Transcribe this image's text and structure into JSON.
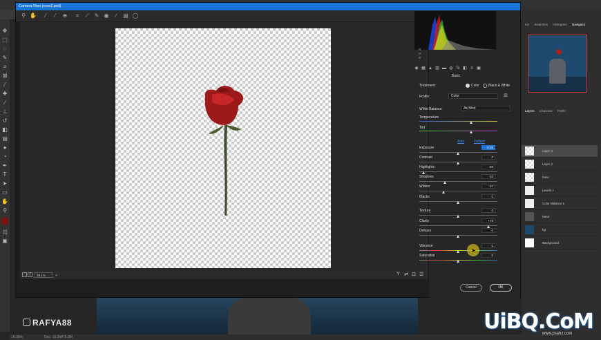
{
  "window": {
    "title": "Camera Raw (rose2.psd)"
  },
  "photoshop": {
    "navigator_tabs": [
      "Ion",
      "Swatches",
      "Histogram",
      "Navigator"
    ],
    "layers_tabs": [
      "Layers",
      "Channels",
      "Paths"
    ],
    "layers": [
      {
        "name": "Layer 3",
        "selected": true
      },
      {
        "name": "Layer 2",
        "selected": false
      },
      {
        "name": "base",
        "selected": false
      },
      {
        "name": "Levels 1",
        "selected": false
      },
      {
        "name": "Color Balance 1",
        "selected": false
      },
      {
        "name": "hand",
        "selected": false
      },
      {
        "name": "bg",
        "selected": false
      },
      {
        "name": "Background",
        "selected": false
      }
    ],
    "status_zoom": "16.35%",
    "status_doc": "Doc: 10.3M/75.3M"
  },
  "camera_raw": {
    "zoom": "38.1%",
    "readout": {
      "r": "R:",
      "g": "G:",
      "b": "B:"
    },
    "panel_title": "Basic",
    "treatment_label": "Treatment:",
    "treatment_color": "Color",
    "treatment_bw": "Black & White",
    "profile_label": "Profile:",
    "profile_value": "Color",
    "white_balance_label": "White Balance:",
    "white_balance_value": "As Shot",
    "temperature_label": "Temperature",
    "tint_label": "Tint",
    "auto_label": "Auto",
    "default_label": "Default",
    "sliders": [
      {
        "label": "Exposure",
        "value": "-0.02",
        "pos": 0.5
      },
      {
        "label": "Contrast",
        "value": "0",
        "pos": 0.5
      },
      {
        "label": "Highlights",
        "value": "-89",
        "pos": 0.06
      },
      {
        "label": "Shadows",
        "value": "-33",
        "pos": 0.33
      },
      {
        "label": "Whites",
        "value": "-37",
        "pos": 0.31
      },
      {
        "label": "Blacks",
        "value": "0",
        "pos": 0.5
      },
      {
        "label": "Texture",
        "value": "0",
        "pos": 0.5
      },
      {
        "label": "Clarity",
        "value": "+78",
        "pos": 0.89
      },
      {
        "label": "Dehaze",
        "value": "0",
        "pos": 0.5
      },
      {
        "label": "Vibrance",
        "value": "0",
        "pos": 0.5
      },
      {
        "label": "Saturation",
        "value": "0",
        "pos": 0.5
      }
    ],
    "cancel_label": "Cancel",
    "ok_label": "OK"
  },
  "watermarks": {
    "handle": "RAFYA88",
    "logo": "UiBQ.CoM",
    "url": "www.psahz.com"
  },
  "colors": {
    "titlebar": "#1a73d6",
    "rose": "#b0201f",
    "stem": "#3b4a2a"
  }
}
